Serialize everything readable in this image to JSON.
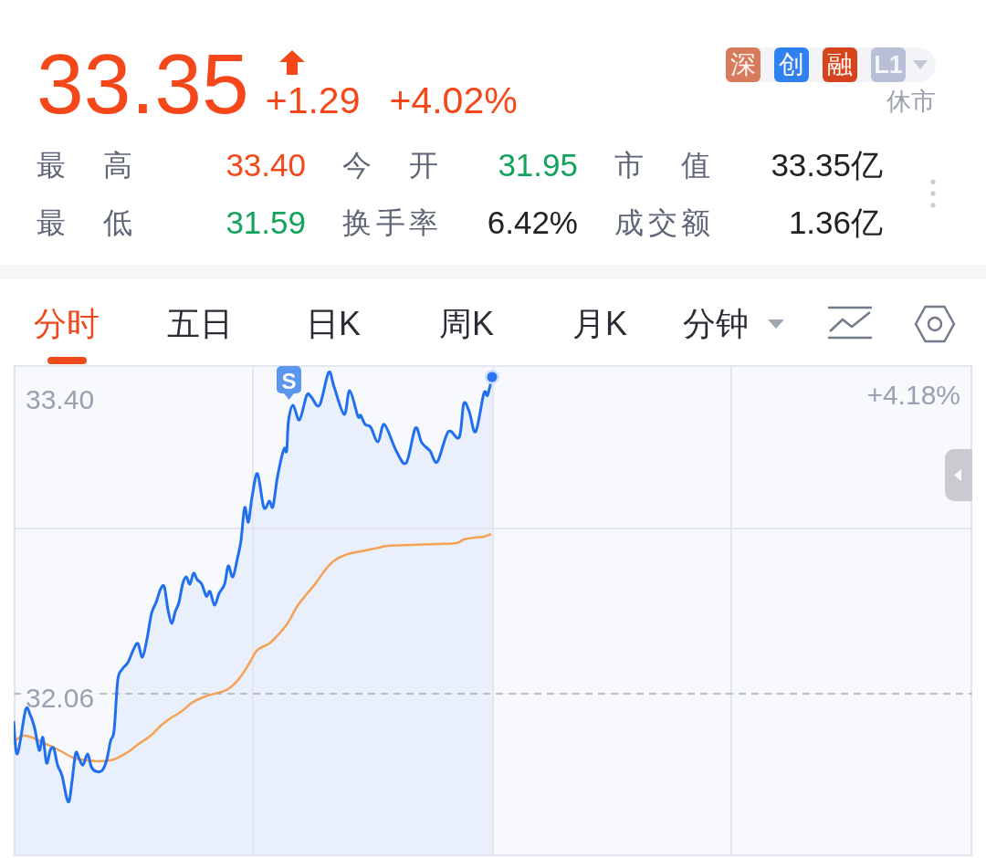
{
  "quote": {
    "price": "33.35",
    "change": "+1.29",
    "change_pct": "+4.02%",
    "rising": true
  },
  "market_tags": [
    {
      "label": "深",
      "color": "#d87b5c"
    },
    {
      "label": "创",
      "color": "#2f80f0"
    },
    {
      "label": "融",
      "color": "#d6441e"
    }
  ],
  "quote_level": {
    "label": "L1"
  },
  "market_status": "休市",
  "stats": [
    {
      "label": "最 高",
      "value": "33.40",
      "color": "#f5481a"
    },
    {
      "label": "今 开",
      "value": "31.95",
      "color": "#14a35c"
    },
    {
      "label": "市 值",
      "value": "33.35亿",
      "color": "#222222"
    },
    {
      "label": "最 低",
      "value": "31.59",
      "color": "#14a35c"
    },
    {
      "label": "换手率",
      "value": "6.42%",
      "color": "#222222"
    },
    {
      "label": "成交额",
      "value": "1.36亿",
      "color": "#222222"
    }
  ],
  "tabs": [
    {
      "label": "分时",
      "selected": true,
      "dropdown": false
    },
    {
      "label": "五日",
      "selected": false,
      "dropdown": false
    },
    {
      "label": "日K",
      "selected": false,
      "dropdown": false
    },
    {
      "label": "周K",
      "selected": false,
      "dropdown": false
    },
    {
      "label": "月K",
      "selected": false,
      "dropdown": false
    },
    {
      "label": "分钟",
      "selected": false,
      "dropdown": true
    }
  ],
  "chart": {
    "high_label": "33.40",
    "prev_close_label": "32.06",
    "high_pct_label": "+4.18%",
    "marker": "S"
  }
}
